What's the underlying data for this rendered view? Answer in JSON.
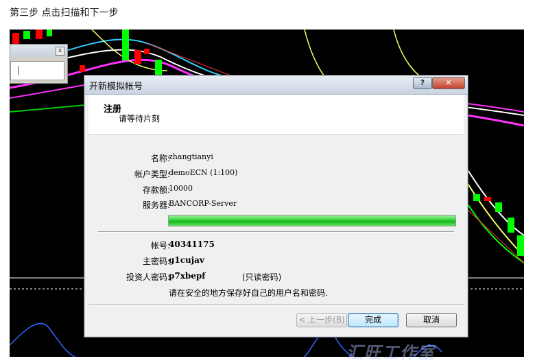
{
  "caption": "第三步 点击扫描和下一步",
  "watermark": "汇旺工作室",
  "dialog": {
    "title": "开新模拟帐号",
    "help_label": "?",
    "close_label": "✕",
    "header_title": "注册",
    "header_subtitle": "请等待片刻",
    "fields": {
      "name_label": "名称:",
      "name_value": "zhangtianyi",
      "type_label": "帐户类型:",
      "type_value": "demoECN (1:100)",
      "deposit_label": "存款额:",
      "deposit_value": "10000",
      "server_label": "服务器:",
      "server_value": "BANCORP-Server",
      "account_label": "帐号:",
      "account_value": "40341175",
      "password_label": "主密码:",
      "password_value": "g1cujav",
      "investor_label": "投资人密码:",
      "investor_value": "p7xbepf",
      "investor_note": "(只读密码)"
    },
    "progress_percent": 100,
    "save_note": "请在安全的地方保存好自己的用户名和密码.",
    "buttons": {
      "back": "< 上一步(B)",
      "finish": "完成",
      "cancel": "取消"
    }
  },
  "colors": {
    "chart_bg": "#000000",
    "progress_green": "#22c426",
    "candle_red": "#ff0000",
    "candle_green": "#00ff00"
  }
}
